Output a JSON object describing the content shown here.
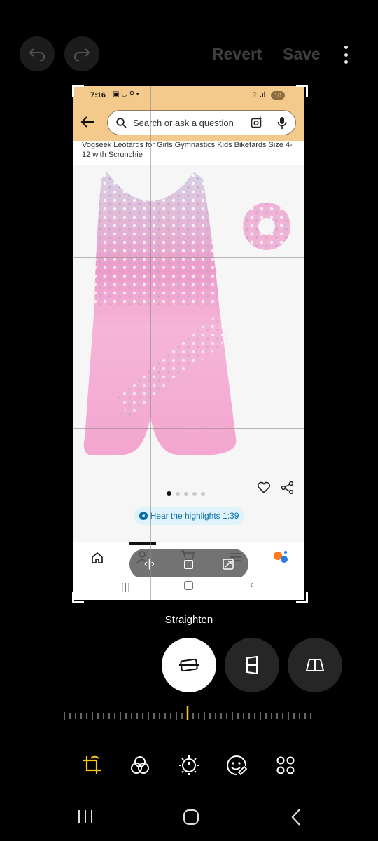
{
  "top_bar": {
    "undo_icon": "undo-icon",
    "redo_icon": "redo-icon",
    "revert_label": "Revert",
    "save_label": "Save"
  },
  "screenshot": {
    "status_bar": {
      "time": "7:16",
      "battery": "18"
    },
    "search": {
      "placeholder": "Search or ask a question"
    },
    "product_title": "Vogseek Leotards for Girls Gymnastics Kids Biketards Size 4-12 with Scrunchie",
    "carousel": {
      "dots": 5,
      "active": 0
    },
    "highlights_label": "Hear the highlights 1:39",
    "colors": {
      "header": "#f3c98c",
      "accent": "#0a6ea6"
    }
  },
  "editor": {
    "mode_label": "Straighten",
    "tools": [
      "straighten-icon",
      "vertical-perspective-icon",
      "horizontal-perspective-icon"
    ],
    "active_tool": "straighten-icon",
    "accent_color": "#f5c518"
  },
  "bottom_toolbar": {
    "items": [
      "crop-rotate-icon",
      "filters-icon",
      "adjust-icon",
      "sticker-icon",
      "more-tools-icon"
    ],
    "active": "crop-rotate-icon"
  }
}
